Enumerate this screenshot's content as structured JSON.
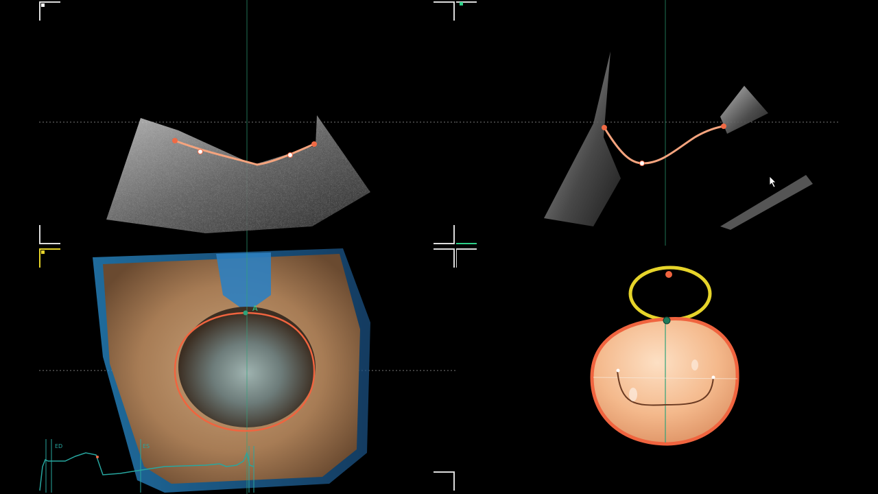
{
  "colors": {
    "background": "#000000",
    "crosshair": "#7a7a7a",
    "axis_line": "#2fa37a",
    "annulus_trace": "#f07a55",
    "annulus_fill": "#f5b48a",
    "aortic_ring": "#e6d42a",
    "ecg_trace": "#27a7a0",
    "corner_view1": "#ffffff",
    "corner_view2": "#2fd18a",
    "corner_view3": "#e6d42a"
  },
  "icons": {
    "cursor": "mouse-pointer-icon"
  },
  "volume_view": {
    "annulus_marker_label": "A"
  },
  "ecg": {
    "ed_label": "ED",
    "es_label": "ES"
  }
}
